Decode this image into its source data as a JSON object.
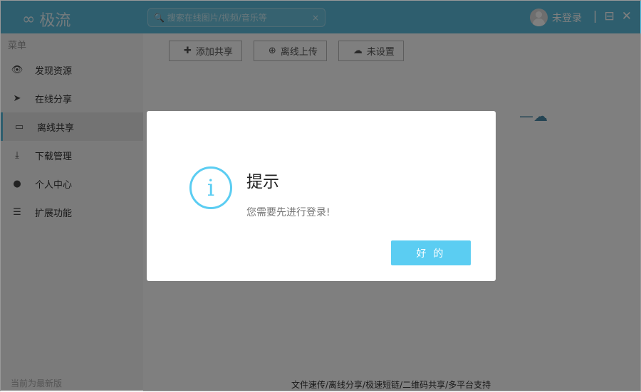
{
  "app": {
    "logo": "极流",
    "logo_mark": "∞"
  },
  "search": {
    "placeholder": "搜索在线图片/视频/音乐等",
    "clear": "×"
  },
  "user": {
    "label": "未登录"
  },
  "window": {
    "separator": "|",
    "restore": "⊟",
    "close": "✕"
  },
  "sidebar": {
    "title": "菜单",
    "items": [
      {
        "label": "发现资源",
        "icon": "👁"
      },
      {
        "label": "在线分享",
        "icon": "➤"
      },
      {
        "label": "离线共享",
        "icon": "▭"
      },
      {
        "label": "下载管理",
        "icon": "⤓"
      },
      {
        "label": "个人中心",
        "icon": "●"
      },
      {
        "label": "扩展功能",
        "icon": "☰"
      }
    ],
    "version": "当前为最新版"
  },
  "toolbar": {
    "add": "添加共享",
    "upload": "离线上传",
    "settings": "未设置"
  },
  "footer": "文件速传/离线分享/极速短链/二维码共享/多平台支持",
  "dialog": {
    "title": "提示",
    "message": "您需要先进行登录!",
    "ok": "好 的",
    "icon": "i"
  },
  "colors": {
    "accent": "#5cbcdc",
    "button": "#5bcdf2"
  }
}
